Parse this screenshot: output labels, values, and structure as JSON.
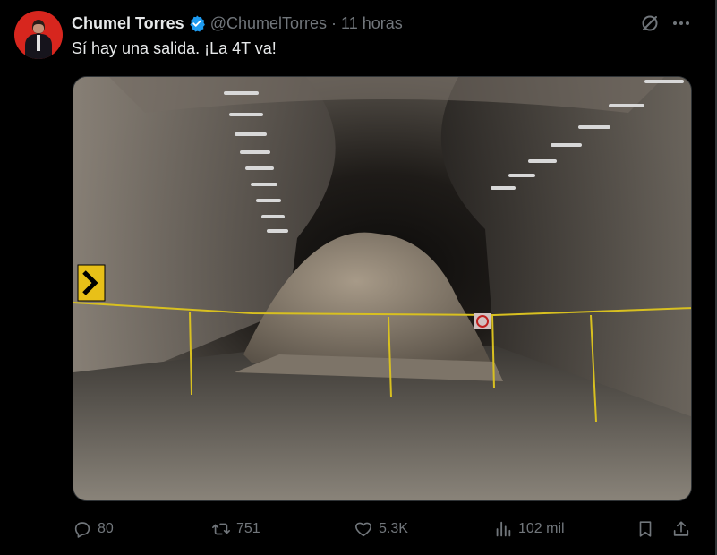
{
  "author": {
    "name": "Chumel Torres",
    "handle": "@ChumelTorres",
    "separator": "·",
    "time": "11 horas",
    "verified_color": "#1d9bf0"
  },
  "tweet": {
    "text": "Sí hay una salida. ¡La 4T va!"
  },
  "actions": {
    "reply_count": "80",
    "retweet_count": "751",
    "like_count": "5.3K",
    "views_count": "102 mil"
  },
  "icons": {
    "header": [
      "grok-icon",
      "more-icon"
    ],
    "actions": [
      "reply-icon",
      "retweet-icon",
      "like-icon",
      "views-icon",
      "bookmark-icon",
      "share-icon"
    ]
  },
  "colors": {
    "background": "#000000",
    "text_primary": "#e7e9ea",
    "text_secondary": "#71767b",
    "border": "#2f3336"
  }
}
